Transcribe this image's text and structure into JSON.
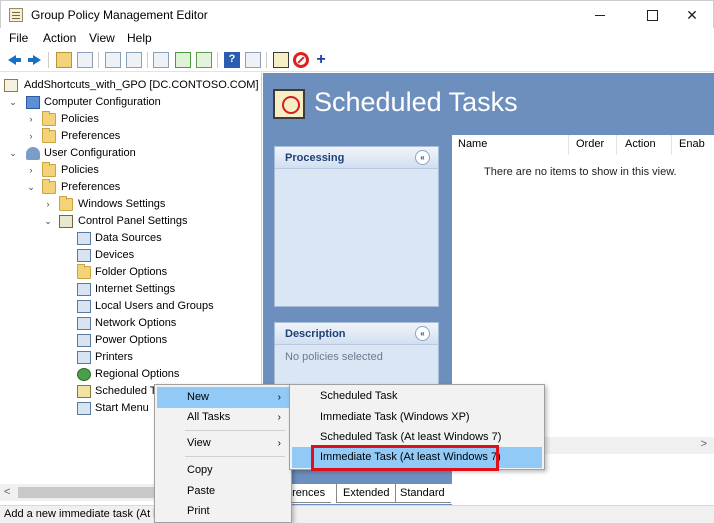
{
  "window": {
    "title": "Group Policy Management Editor",
    "controls": {
      "minimize": "",
      "maximize": "",
      "close": "✕"
    }
  },
  "menubar": [
    "File",
    "Action",
    "View",
    "Help"
  ],
  "toolbar": {
    "icons": [
      "back-arrow-icon",
      "forward-arrow-icon",
      "up-folder-icon",
      "show-hide-tree-icon",
      "copy-icon",
      "paste-icon",
      "print-icon",
      "refresh-icon",
      "export-list-icon",
      "help-icon",
      "properties-icon",
      "new-item-icon",
      "disable-icon",
      "add-icon"
    ],
    "help_glyph": "?",
    "add_glyph": "+"
  },
  "tree": {
    "root": "AddShortcuts_with_GPO [DC.CONTOSO.COM] P",
    "computer_configuration": "Computer Configuration",
    "policies": "Policies",
    "preferences": "Preferences",
    "user_configuration": "User Configuration",
    "windows_settings": "Windows Settings",
    "control_panel_settings": "Control Panel Settings",
    "items": [
      "Data Sources",
      "Devices",
      "Folder Options",
      "Internet Settings",
      "Local Users and Groups",
      "Network Options",
      "Power Options",
      "Printers",
      "Regional Options",
      "Scheduled Ta",
      "Start Menu"
    ],
    "expand_glyph": "⌄",
    "collapse_glyph": "›"
  },
  "right_panel": {
    "title": "Scheduled Tasks",
    "processing_label": "Processing",
    "description_label": "Description",
    "description_text": "No policies selected",
    "collapse_glyph": "«",
    "columns": [
      "Name",
      "Order",
      "Action",
      "Enab"
    ],
    "empty_text": "There are no items to show in this view.",
    "tabs": [
      "erences",
      "Extended",
      "Standard"
    ]
  },
  "context_menu": {
    "items": [
      "New",
      "All Tasks",
      "View",
      "Copy",
      "Paste",
      "Print"
    ],
    "submenu_arrow": "›"
  },
  "new_submenu": {
    "items": [
      "Scheduled Task",
      "Immediate Task (Windows XP)",
      "Scheduled Task (At least Windows 7)",
      "Immediate Task (At least Windows 7)"
    ]
  },
  "status_bar": "Add a new immediate task (At l",
  "colors": {
    "panel_blue": "#6d8fbd",
    "menu_highlight": "#91c9f7",
    "annotation_red": "#e0101a"
  }
}
